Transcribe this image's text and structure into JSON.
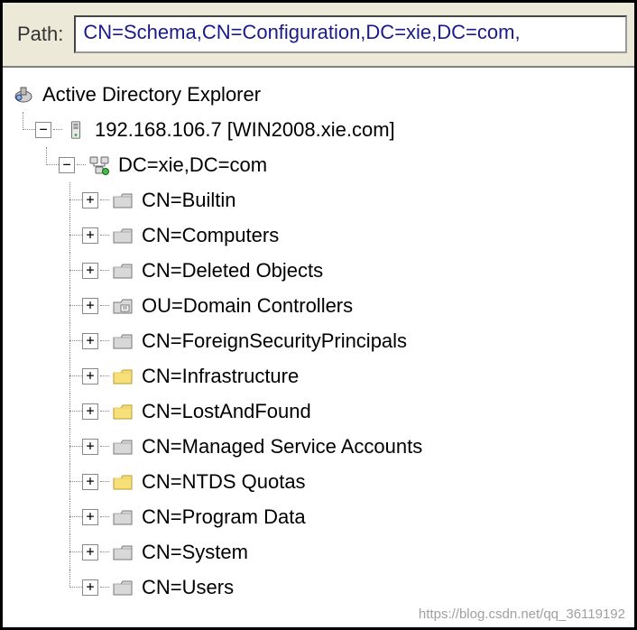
{
  "pathbar": {
    "label": "Path:",
    "value": "CN=Schema,CN=Configuration,DC=xie,DC=com,"
  },
  "tree": {
    "root": {
      "label": "Active Directory Explorer",
      "icon": "explorer"
    },
    "server": {
      "label": "192.168.106.7 [WIN2008.xie.com]",
      "icon": "server",
      "expander": "−"
    },
    "domain": {
      "label": "DC=xie,DC=com",
      "icon": "domain",
      "expander": "−"
    },
    "children": [
      {
        "label": "CN=Builtin",
        "icon": "container",
        "expander": "+"
      },
      {
        "label": "CN=Computers",
        "icon": "container",
        "expander": "+"
      },
      {
        "label": "CN=Deleted Objects",
        "icon": "container",
        "expander": "+"
      },
      {
        "label": "OU=Domain Controllers",
        "icon": "ou",
        "expander": "+"
      },
      {
        "label": "CN=ForeignSecurityPrincipals",
        "icon": "container",
        "expander": "+"
      },
      {
        "label": "CN=Infrastructure",
        "icon": "folder",
        "expander": "+"
      },
      {
        "label": "CN=LostAndFound",
        "icon": "folder",
        "expander": "+"
      },
      {
        "label": "CN=Managed Service Accounts",
        "icon": "container",
        "expander": "+"
      },
      {
        "label": "CN=NTDS Quotas",
        "icon": "folder",
        "expander": "+"
      },
      {
        "label": "CN=Program Data",
        "icon": "container",
        "expander": "+"
      },
      {
        "label": "CN=System",
        "icon": "container",
        "expander": "+"
      },
      {
        "label": "CN=Users",
        "icon": "container",
        "expander": "+"
      }
    ]
  },
  "watermark": "https://blog.csdn.net/qq_36119192"
}
